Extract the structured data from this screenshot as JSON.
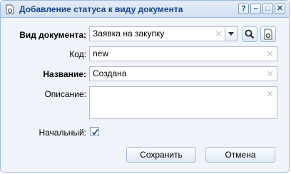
{
  "window": {
    "title": "Добавление статуса к виду документа",
    "tools": {
      "help": "?",
      "minimize": "–",
      "maximize": "□",
      "close": "✕"
    }
  },
  "form": {
    "doc_type": {
      "label": "Вид документа:",
      "value": "Заявка на закупку"
    },
    "code": {
      "label": "Код:",
      "value": "new"
    },
    "name": {
      "label": "Название:",
      "value": "Создана"
    },
    "description": {
      "label": "Описание:",
      "value": ""
    },
    "initial": {
      "label": "Начальный:",
      "checked": true
    }
  },
  "buttons": {
    "save": "Сохранить",
    "cancel": "Отмена"
  },
  "icons": {
    "title": "document-icon",
    "search": "search-icon",
    "edit": "document-gear-icon",
    "clear": "clear-x-icon"
  },
  "colors": {
    "title_text": "#15428b",
    "border": "#99bbe8",
    "body_bg": "#f0f4fa"
  }
}
